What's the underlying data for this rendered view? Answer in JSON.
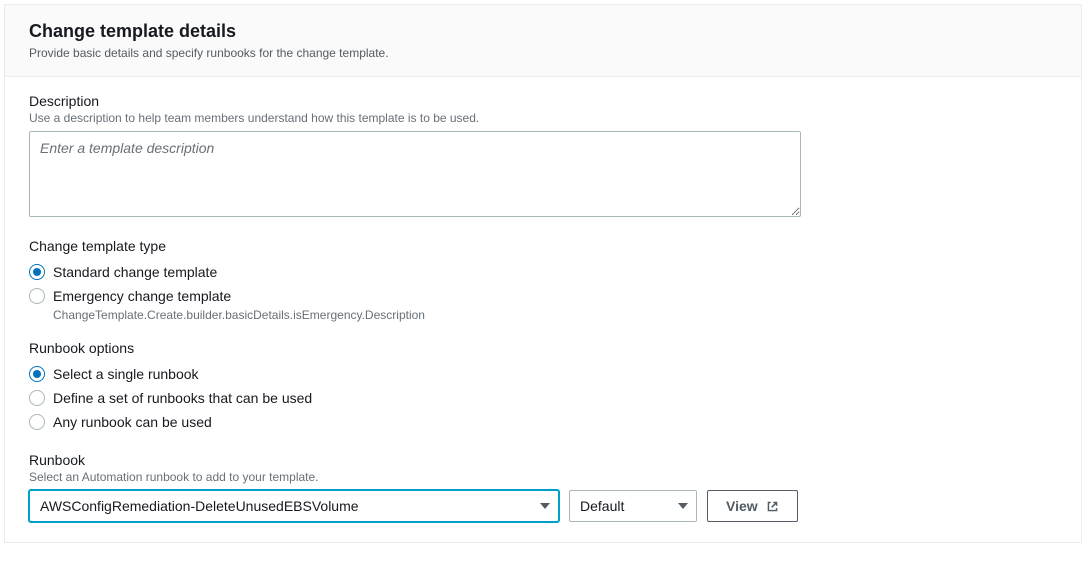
{
  "header": {
    "title": "Change template details",
    "subtitle": "Provide basic details and specify runbooks for the change template."
  },
  "description": {
    "label": "Description",
    "hint": "Use a description to help team members understand how this template is to be used.",
    "placeholder": "Enter a template description",
    "value": ""
  },
  "templateType": {
    "label": "Change template type",
    "options": [
      {
        "label": "Standard change template",
        "selected": true
      },
      {
        "label": "Emergency change template",
        "selected": false,
        "sublabel": "ChangeTemplate.Create.builder.basicDetails.isEmergency.Description"
      }
    ]
  },
  "runbookOptions": {
    "label": "Runbook options",
    "options": [
      {
        "label": "Select a single runbook",
        "selected": true
      },
      {
        "label": "Define a set of runbooks that can be used",
        "selected": false
      },
      {
        "label": "Any runbook can be used",
        "selected": false
      }
    ]
  },
  "runbook": {
    "label": "Runbook",
    "hint": "Select an Automation runbook to add to your template.",
    "selected": "AWSConfigRemediation-DeleteUnusedEBSVolume",
    "version": "Default",
    "viewLabel": "View"
  }
}
